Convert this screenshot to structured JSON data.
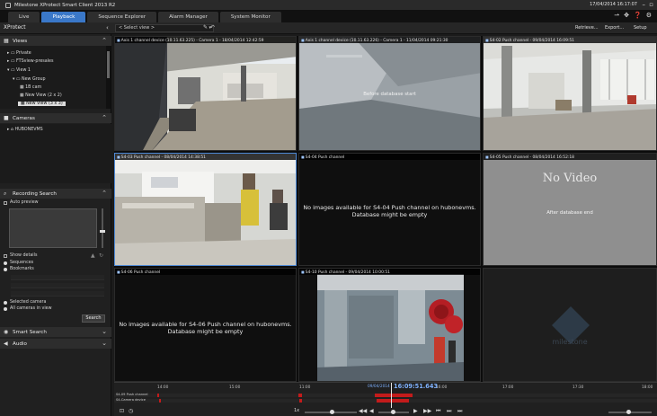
{
  "app": {
    "title": "Milestone XProtect Smart Client 2013 R2",
    "clock": "17/04/2014 16:17:07"
  },
  "tabs": [
    {
      "label": "Live"
    },
    {
      "label": "Playback"
    },
    {
      "label": "Sequence Explorer"
    },
    {
      "label": "Alarm Manager"
    },
    {
      "label": "System Monitor"
    }
  ],
  "subheader": {
    "brand": "XProtect",
    "view_selector": "< Select view >",
    "buttons": [
      "Retrieve...",
      "Export...",
      "Setup"
    ]
  },
  "sidebar": {
    "views_title": "Views",
    "views_tree": [
      {
        "label": "Private"
      },
      {
        "label": "FTSview-presales"
      },
      {
        "label": "View 1"
      },
      {
        "label": "New Group"
      },
      {
        "label": "1B cam"
      },
      {
        "label": "New View (2 x 2)"
      },
      {
        "label": "New View (3 x 3)"
      }
    ],
    "cameras_title": "Cameras",
    "cameras_tree": [
      {
        "label": "HUBONEVMS"
      }
    ],
    "recording_search_title": "Recording Search",
    "auto_preview": "Auto preview",
    "show_details": "Show details",
    "sequences": "Sequences",
    "bookmarks": "Bookmarks",
    "selected_camera": "Selected camera",
    "all_cameras": "All cameras in view",
    "search_button": "Search",
    "smart_search_title": "Smart Search",
    "audio_title": "Audio"
  },
  "tiles": [
    {
      "caption": "Axis 1 channel device (10.11.63.225) - Camera 1 - 18/04/2014 12:42:59",
      "message": ""
    },
    {
      "caption": "Axis 1 channel device (10.11.63.226) - Camera 1 - 11/04/2014 09:21:30",
      "message": "Before database start"
    },
    {
      "caption": "S4-02 Push channel - 09/04/2014 16:09:51",
      "message": ""
    },
    {
      "caption": "S4-03 Push channel - 08/04/2014 14:38:51",
      "message": ""
    },
    {
      "caption": "S4-04 Push channel",
      "message": "No images available for S4-04 Push channel on hubonevms. Database might be empty"
    },
    {
      "caption": "S4-05 Push channel - 08/04/2014 16:52:18",
      "message": "After database end",
      "no_video": "No Video"
    },
    {
      "caption": "S4-06 Push channel",
      "message": "No images available for S4-06 Push channel on hubonevms. Database might be empty"
    },
    {
      "caption": "S4-10 Push channel - 09/04/2014 10:00:51",
      "message": ""
    },
    {
      "caption": "",
      "message": "",
      "watermark": "milestone"
    }
  ],
  "timeline": {
    "ticks": [
      "14:00",
      "15:00",
      "11:00",
      "16:00",
      "17:00",
      "17:30",
      "18:00"
    ],
    "date": "09/04/2014",
    "time": "16:09:51.643",
    "rows": [
      "S4-09 Push channel",
      "S4-Camera device"
    ]
  },
  "colors": {
    "accent": "#3a78c9",
    "timeline_red": "#c31b1b",
    "time_blue": "#7fb2ff"
  }
}
